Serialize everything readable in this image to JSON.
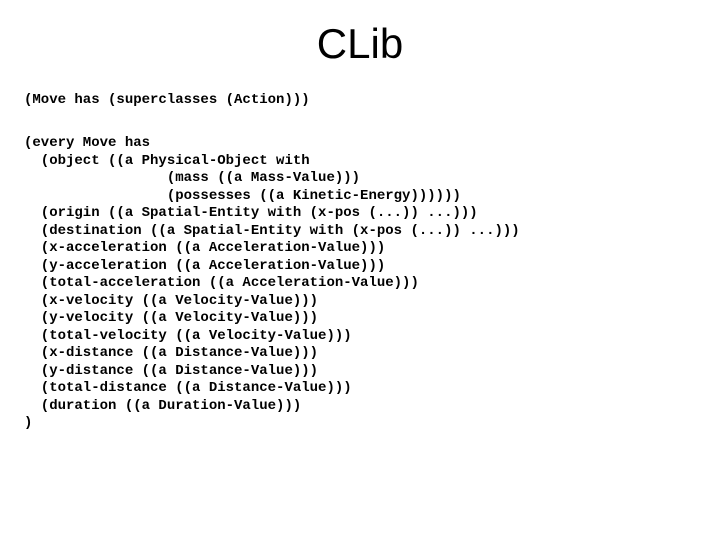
{
  "title": "CLib",
  "line1": "(Move has (superclasses (Action)))",
  "block2_l0": "(every Move has",
  "block2_l1": "  (object ((a Physical-Object with",
  "block2_l2": "                 (mass ((a Mass-Value)))",
  "block2_l3": "                 (possesses ((a Kinetic-Energy))))))",
  "block2_l4": "  (origin ((a Spatial-Entity with (x-pos (...)) ...)))",
  "block2_l5": "  (destination ((a Spatial-Entity with (x-pos (...)) ...)))",
  "block2_l6": "  (x-acceleration ((a Acceleration-Value)))",
  "block2_l7": "  (y-acceleration ((a Acceleration-Value)))",
  "block2_l8": "  (total-acceleration ((a Acceleration-Value)))",
  "block2_l9": "  (x-velocity ((a Velocity-Value)))",
  "block2_l10": "  (y-velocity ((a Velocity-Value)))",
  "block2_l11": "  (total-velocity ((a Velocity-Value)))",
  "block2_l12": "  (x-distance ((a Distance-Value)))",
  "block2_l13": "  (y-distance ((a Distance-Value)))",
  "block2_l14": "  (total-distance ((a Distance-Value)))",
  "block2_l15": "  (duration ((a Duration-Value)))",
  "block2_l16": ")"
}
